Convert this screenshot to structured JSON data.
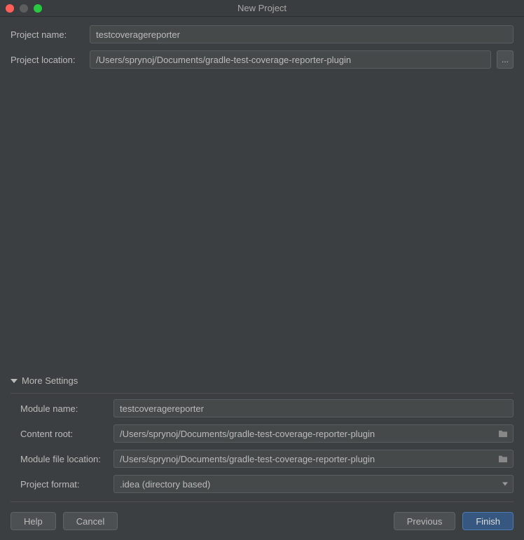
{
  "window": {
    "title": "New Project"
  },
  "fields": {
    "projectName": {
      "label": "Project name:",
      "value": "testcoveragereporter"
    },
    "projectLocation": {
      "label": "Project location:",
      "value": "/Users/sprynoj/Documents/gradle-test-coverage-reporter-plugin"
    }
  },
  "moreSettings": {
    "header": "More Settings",
    "moduleName": {
      "label": "Module name:",
      "value": "testcoveragereporter"
    },
    "contentRoot": {
      "label": "Content root:",
      "value": "/Users/sprynoj/Documents/gradle-test-coverage-reporter-plugin"
    },
    "moduleFileLocation": {
      "label": "Module file location:",
      "value": "/Users/sprynoj/Documents/gradle-test-coverage-reporter-plugin"
    },
    "projectFormat": {
      "label": "Project format:",
      "value": ".idea (directory based)"
    }
  },
  "buttons": {
    "help": "Help",
    "cancel": "Cancel",
    "previous": "Previous",
    "finish": "Finish"
  },
  "browseLabel": "..."
}
